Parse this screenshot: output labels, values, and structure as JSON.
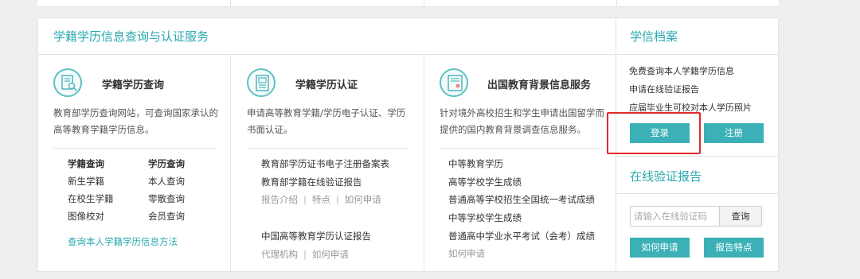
{
  "main_panel": {
    "title": "学籍学历信息查询与认证服务",
    "columns": [
      {
        "icon": "document-search-icon",
        "title": "学籍学历查询",
        "desc": [
          "教育部学历查询网站，可查询国家承认的",
          "高等教育学籍学历信息。"
        ],
        "links": [
          [
            "学籍查询",
            "学历查询"
          ],
          [
            "新生学籍",
            "本人查询"
          ],
          [
            "在校生学籍",
            "零散查询"
          ],
          [
            "图像校对",
            "会员查询"
          ]
        ],
        "footer_link": "查询本人学籍学历信息方法"
      },
      {
        "icon": "document-certify-icon",
        "title": "学籍学历认证",
        "desc": [
          "申请高等教育学籍/学历电子认证、学历",
          "书面认证。"
        ],
        "block1": [
          "教育部学历证书电子注册备案表",
          "教育部学籍在线验证报告"
        ],
        "block1_sub": [
          "报告介绍",
          "特点",
          "如何申请"
        ],
        "block2": "中国高等教育学历认证报告",
        "block2_sub": [
          "代理机构",
          "如何申请"
        ]
      },
      {
        "icon": "certificate-icon",
        "title": "出国教育背景信息服务",
        "desc": [
          "针对境外高校招生和学生申请出国留学而",
          "提供的国内教育背景调查信息服务。"
        ],
        "links": [
          "中等教育学历",
          "高等学校学生成绩",
          "普通高等学校招生全国统一考试成绩",
          "中等学校学生成绩",
          "普通高中学业水平考试（会考）成绩"
        ],
        "sub": "如何申请"
      }
    ]
  },
  "side_panel": {
    "title": "学信档案",
    "lines": [
      "免费查询本人学籍学历信息",
      "申请在线验证报告",
      "应届毕业生可校对本人学历照片"
    ],
    "login_label": "登录",
    "register_label": "注册",
    "verify_title": "在线验证报告",
    "code_placeholder": "请输入在线验证码",
    "query_label": "查询",
    "apply_label": "如何申请",
    "features_label": "报告特点"
  },
  "colors": {
    "accent": "#2aa8b0",
    "button": "#3bb1b7",
    "highlight_box": "#e02a2a"
  }
}
